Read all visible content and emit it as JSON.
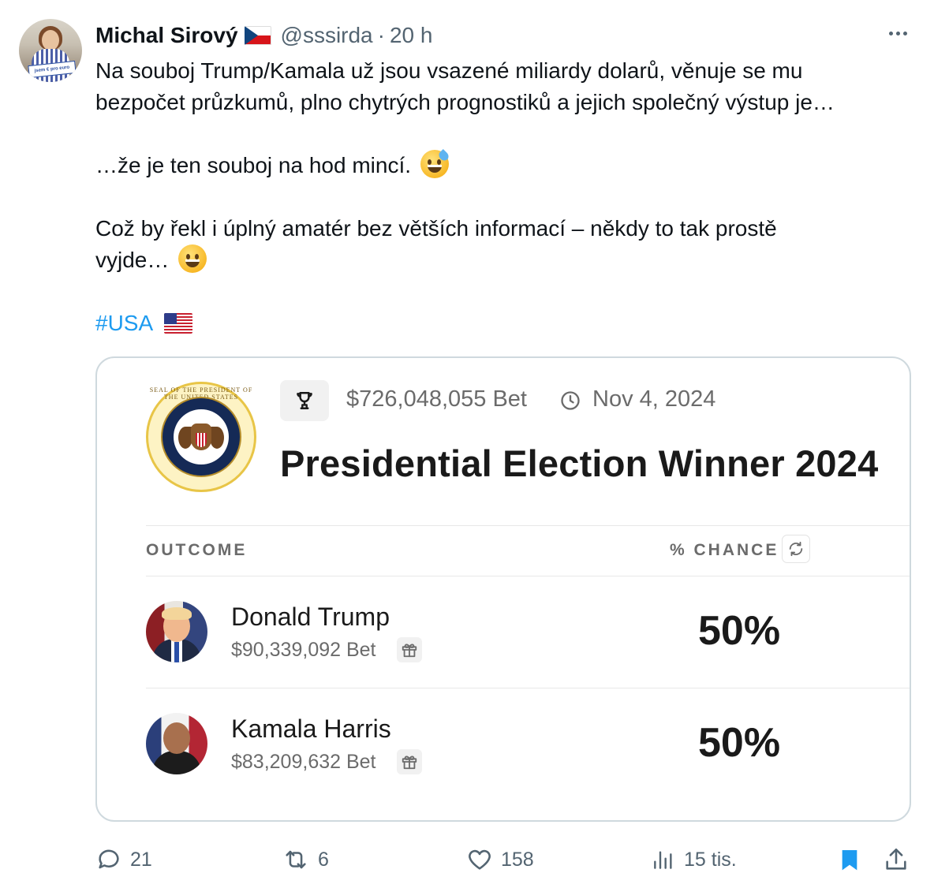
{
  "tweet": {
    "author_name": "Michal Sirový",
    "author_flag": "czech-flag-icon",
    "handle": "@sssirda",
    "separator": "·",
    "time": "20 h",
    "paragraphs": [
      "Na souboj Trump/Kamala už jsou vsazené miliardy dolarů, věnuje se mu",
      "bezpočet průzkumů, plno chytrých prognostiků a jejich společný výstup je…",
      "…že je ten souboj na hod mincí.",
      "Což by řekl i úplný amatér bez větších informací – někdy to tak prostě",
      "vyjde…"
    ],
    "hashtag": "#USA",
    "avatar_sign": "jsem € pro euro"
  },
  "card": {
    "seal_text": "SEAL OF THE PRESIDENT OF THE UNITED STATES",
    "total_bet": "$726,048,055 Bet",
    "date": "Nov 4, 2024",
    "title": "Presidential Election Winner 2024",
    "col_outcome": "OUTCOME",
    "col_chance": "% CHANCE",
    "candidates": [
      {
        "name": "Donald Trump",
        "bet": "$90,339,092 Bet",
        "chance": "50%"
      },
      {
        "name": "Kamala Harris",
        "bet": "$83,209,632 Bet",
        "chance": "50%"
      }
    ]
  },
  "actions": {
    "replies": "21",
    "reposts": "6",
    "likes": "158",
    "views": "15 tis."
  },
  "colors": {
    "link": "#1d9bf0",
    "muted": "#536471",
    "bookmark_active": "#1d9bf0",
    "border": "#cfd9de"
  }
}
